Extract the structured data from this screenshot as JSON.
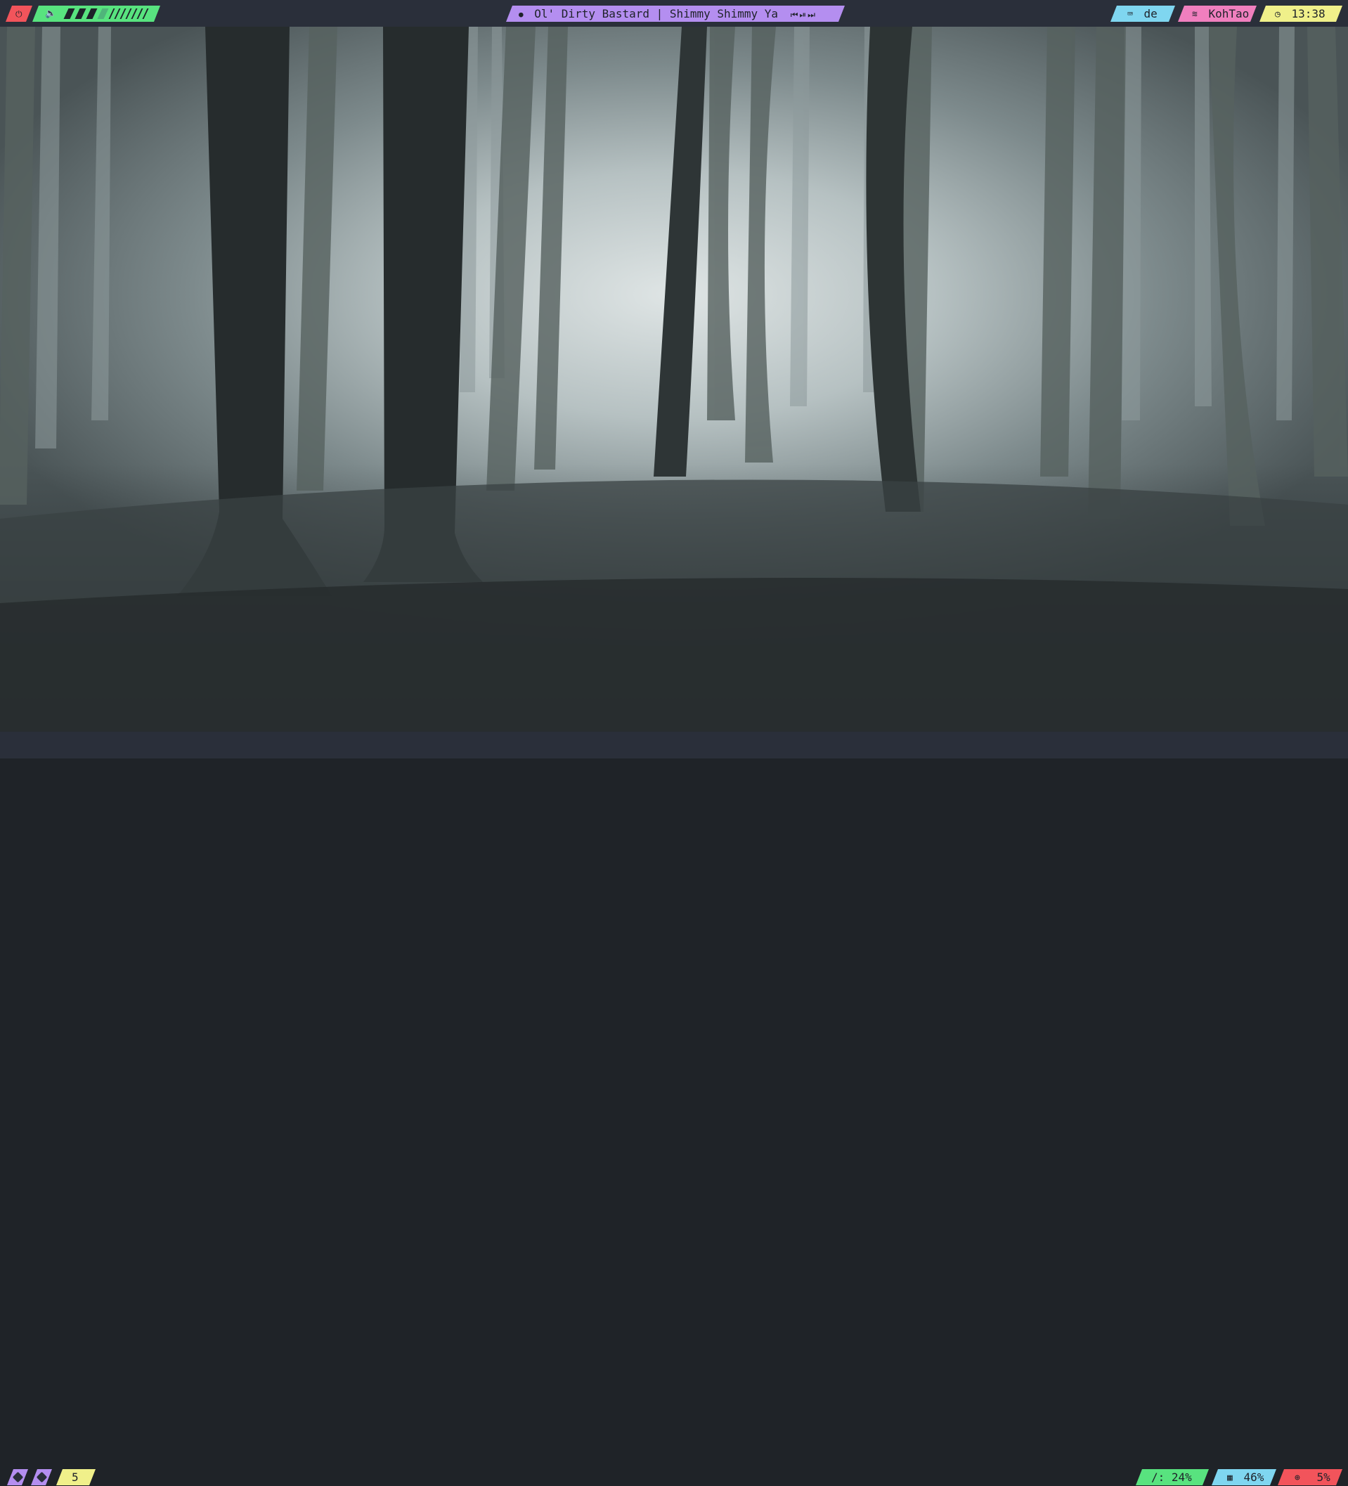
{
  "top_bar": {
    "power_icon": "power-icon",
    "volume": {
      "icon": "speaker-icon",
      "level": 0.33
    },
    "media": {
      "icon": "music-disc-icon",
      "track": "Ol' Dirty Bastard | Shimmy Shimmy Ya",
      "controls": [
        "previous-icon",
        "play-pause-icon",
        "next-icon"
      ],
      "control_glyphs": "⏮ ⏯ ⏭"
    },
    "keyboard": {
      "icon": "keyboard-icon",
      "label": "de"
    },
    "wifi": {
      "icon": "wifi-icon",
      "label": "KohTao"
    },
    "clock": {
      "icon": "clock-icon",
      "label": "13:38"
    }
  },
  "bottom_bar": {
    "workspaces": [
      "workspace-1",
      "workspace-2"
    ],
    "workspace_current": "5",
    "disk": {
      "label": "/: 24%"
    },
    "memory": {
      "icon": "memory-chip-icon",
      "label": "46%"
    },
    "cpu": {
      "icon": "cpu-icon",
      "label": "5%"
    }
  },
  "colors": {
    "bar_bg": "#2a2f3a",
    "red": "#f2545b",
    "green": "#58e37f",
    "purple": "#b48ef0",
    "cyan": "#7fd6f0",
    "pink": "#f07fbe",
    "yellow": "#f0f08a"
  }
}
